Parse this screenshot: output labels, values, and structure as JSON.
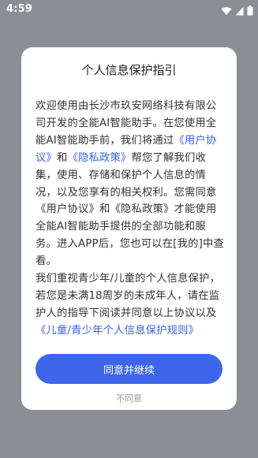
{
  "status_bar": {
    "time": "4:59",
    "icons": [
      "wifi-icon",
      "signal-icon",
      "battery-icon"
    ]
  },
  "dialog": {
    "title": "个人信息保护指引",
    "para1": {
      "text_1": "欢迎使用由长沙市玖安网络科技有限公司开发的全能AI智能助手。在您使用全能AI智能助手前，我们将通过",
      "link_1": "《用户协议》",
      "text_2": "和",
      "link_2": "《隐私政策》",
      "text_3": "帮您了解我们收集，使用、存储和保护个人信息的情况，以及您享有的相关权利。您需同意《用户协议》和《隐私政策》才能使用全能AI智能助手提供的全部功能和服务。进入APP后，您也可以在[我的]中查看。"
    },
    "para2": {
      "text_1": "我们重视青少年/儿童的个人信息保护，若您是未满18周岁的未成年人，请在监护人的指导下阅读并同意以上协议以及",
      "link_1": "《儿童/青少年个人信息保护规则》"
    },
    "agree_button": "同意并继续",
    "disagree_button": "不同意"
  },
  "colors": {
    "accent": "#3d66ea",
    "link": "#3a63e8",
    "overlay": "#8b8f94"
  }
}
